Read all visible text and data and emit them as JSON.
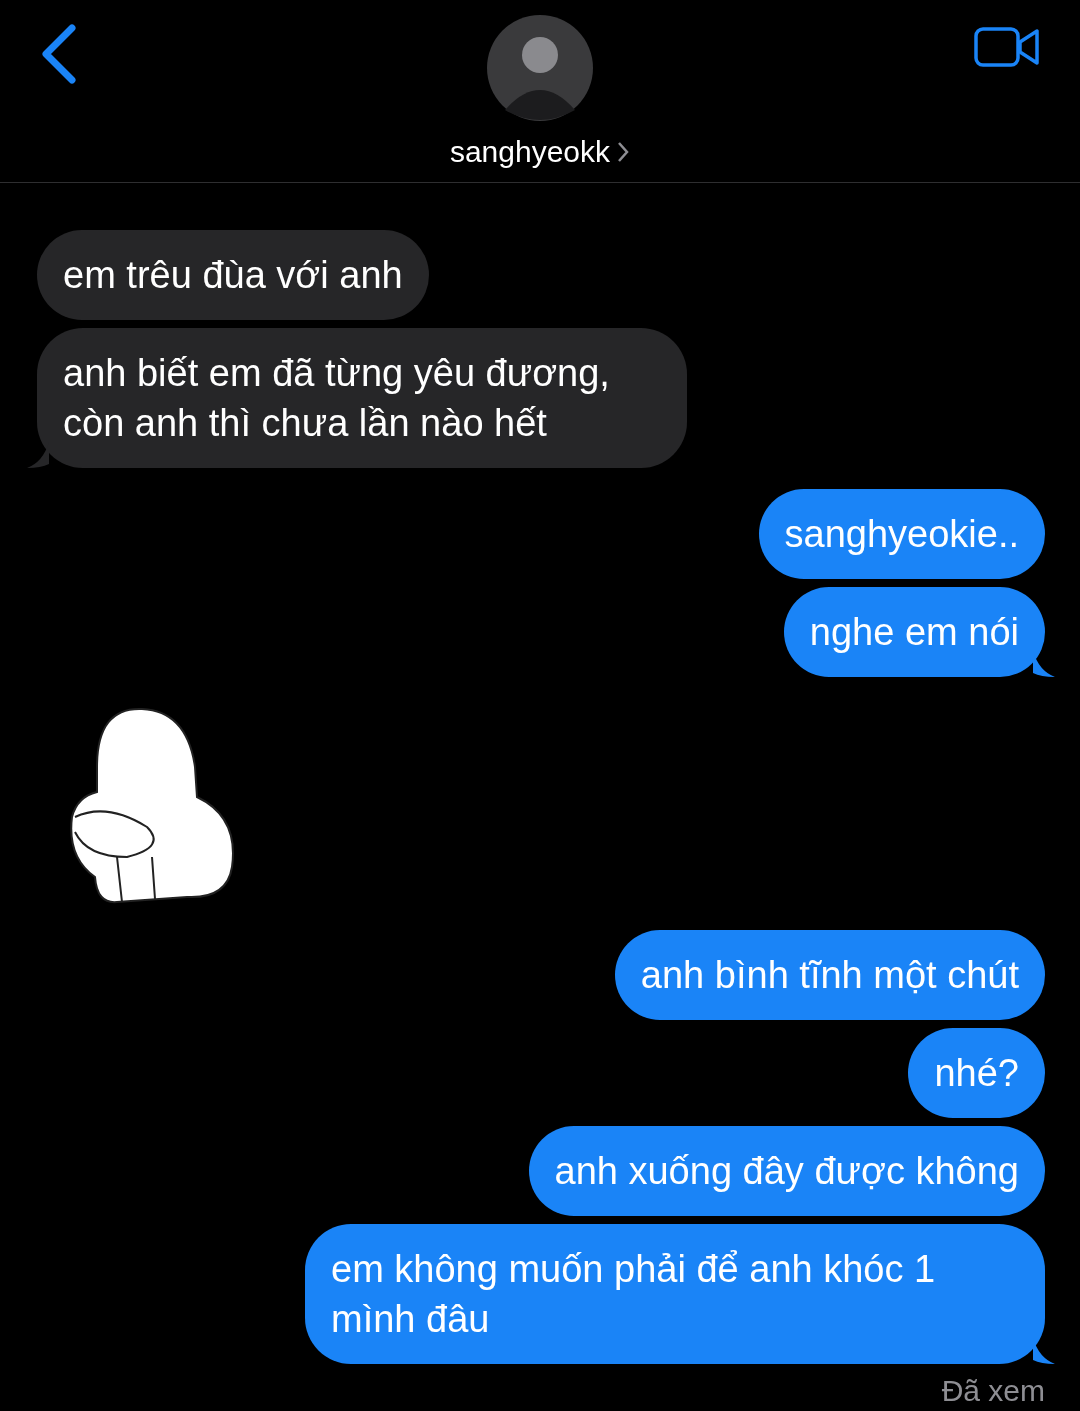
{
  "header": {
    "contact_name": "sanghyeokk"
  },
  "messages": [
    {
      "kind": "text",
      "sent": false,
      "text": "em trêu đùa với anh",
      "tail": false
    },
    {
      "kind": "text",
      "sent": false,
      "text": "anh biết em đã từng yêu đương, còn anh thì chưa lần nào hết",
      "tail": true
    },
    {
      "kind": "text",
      "sent": true,
      "text": "sanghyeokie..",
      "tail": false
    },
    {
      "kind": "text",
      "sent": true,
      "text": "nghe em nói",
      "tail": true
    },
    {
      "kind": "sticker",
      "sent": false
    },
    {
      "kind": "text",
      "sent": true,
      "text": "anh bình tĩnh một chút",
      "tail": false
    },
    {
      "kind": "text",
      "sent": true,
      "text": "nhé?",
      "tail": false
    },
    {
      "kind": "text",
      "sent": true,
      "text": "anh xuống đây được không",
      "tail": false
    },
    {
      "kind": "text",
      "sent": true,
      "text": "em không muốn phải để anh khóc 1 mình đâu",
      "tail": true
    }
  ],
  "read_receipt": "Đã xem"
}
